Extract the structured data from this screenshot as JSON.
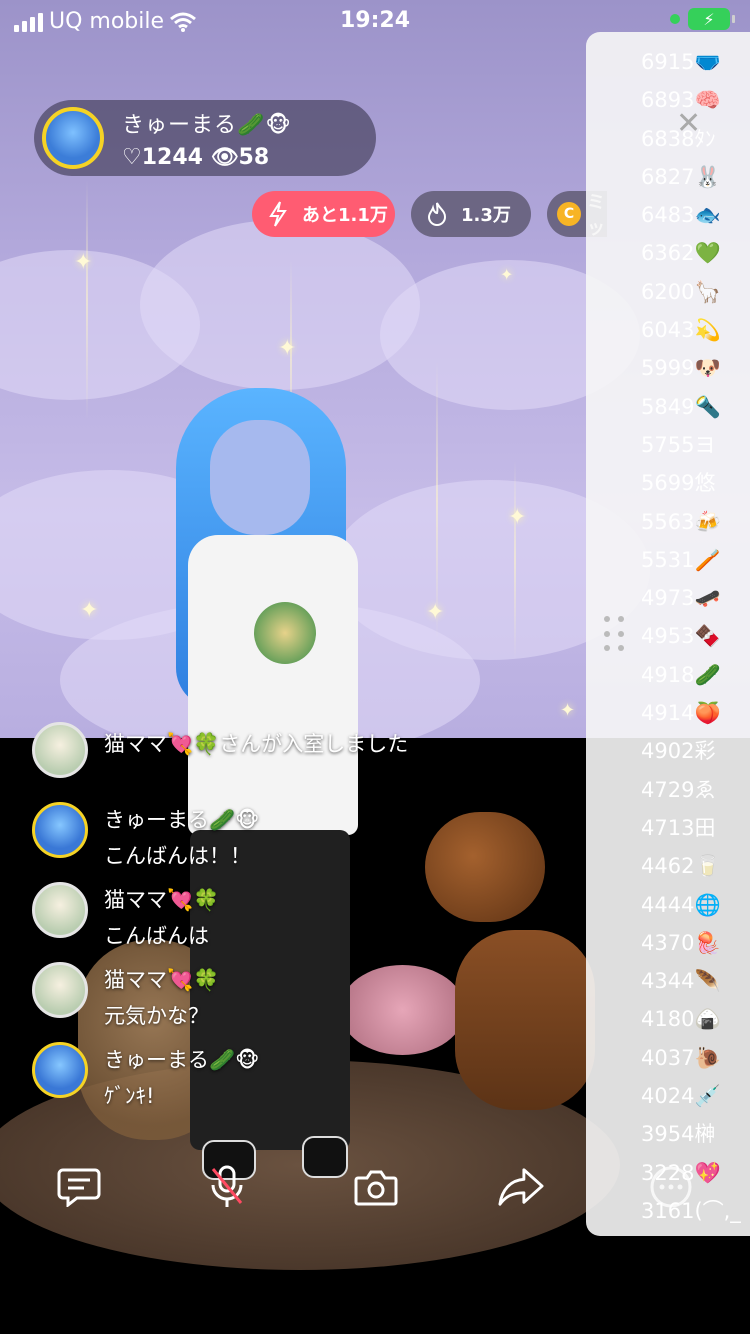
{
  "status_bar": {
    "carrier": "UQ mobile",
    "time": "19:24"
  },
  "host": {
    "name": "きゅーまる🥒🐵",
    "hearts": "♡1244",
    "viewers": "👁58"
  },
  "pills": {
    "goal": "あと1.1万",
    "fire": "1.3万",
    "coin_text": "ミッ"
  },
  "comments": [
    {
      "avatar": "cat",
      "user": "猫ママ💘🍀",
      "text": "さんが入室しました",
      "inline": true
    },
    {
      "avatar": "blue",
      "user": "きゅーまる🥒🐵",
      "text": "こんばんは！！"
    },
    {
      "avatar": "cat",
      "user": "猫ママ💘🍀",
      "text": "こんばんは"
    },
    {
      "avatar": "cat",
      "user": "猫ママ💘🍀",
      "text": "元気かな？"
    },
    {
      "avatar": "blue",
      "user": "きゅーまる🥒🐵",
      "text": "ｹﾞﾝｷ!"
    }
  ],
  "ranking": [
    "6915🩲",
    "6893🧠",
    "6838ﾀﾝ",
    "6827🐰",
    "6483🐟",
    "6362💚",
    "6200🦙",
    "6043💫",
    "5999🐶",
    "5849🔦",
    "5755ヨ",
    "5699悠",
    "5563🍻",
    "5531🪥",
    "4973🛹",
    "4953🍫",
    "4918🥒",
    "4914🍑",
    "4902彩",
    "4729ゑ",
    "4713田",
    "4462🥛",
    "4444🌐",
    "4370🪼",
    "4344🪶",
    "4180🍙",
    "4037🐌",
    "4024💉",
    "3954榊",
    "3228💖",
    "3161(⌒,_"
  ],
  "icons": {
    "comment": "comment-icon",
    "mic": "mic-muted-icon",
    "camera": "camera-icon",
    "share": "share-icon",
    "more": "more-icon"
  },
  "colors": {
    "goal_pill": "#ff5c72",
    "avatar_ring": "#f5d325",
    "battery": "#35d05a"
  }
}
